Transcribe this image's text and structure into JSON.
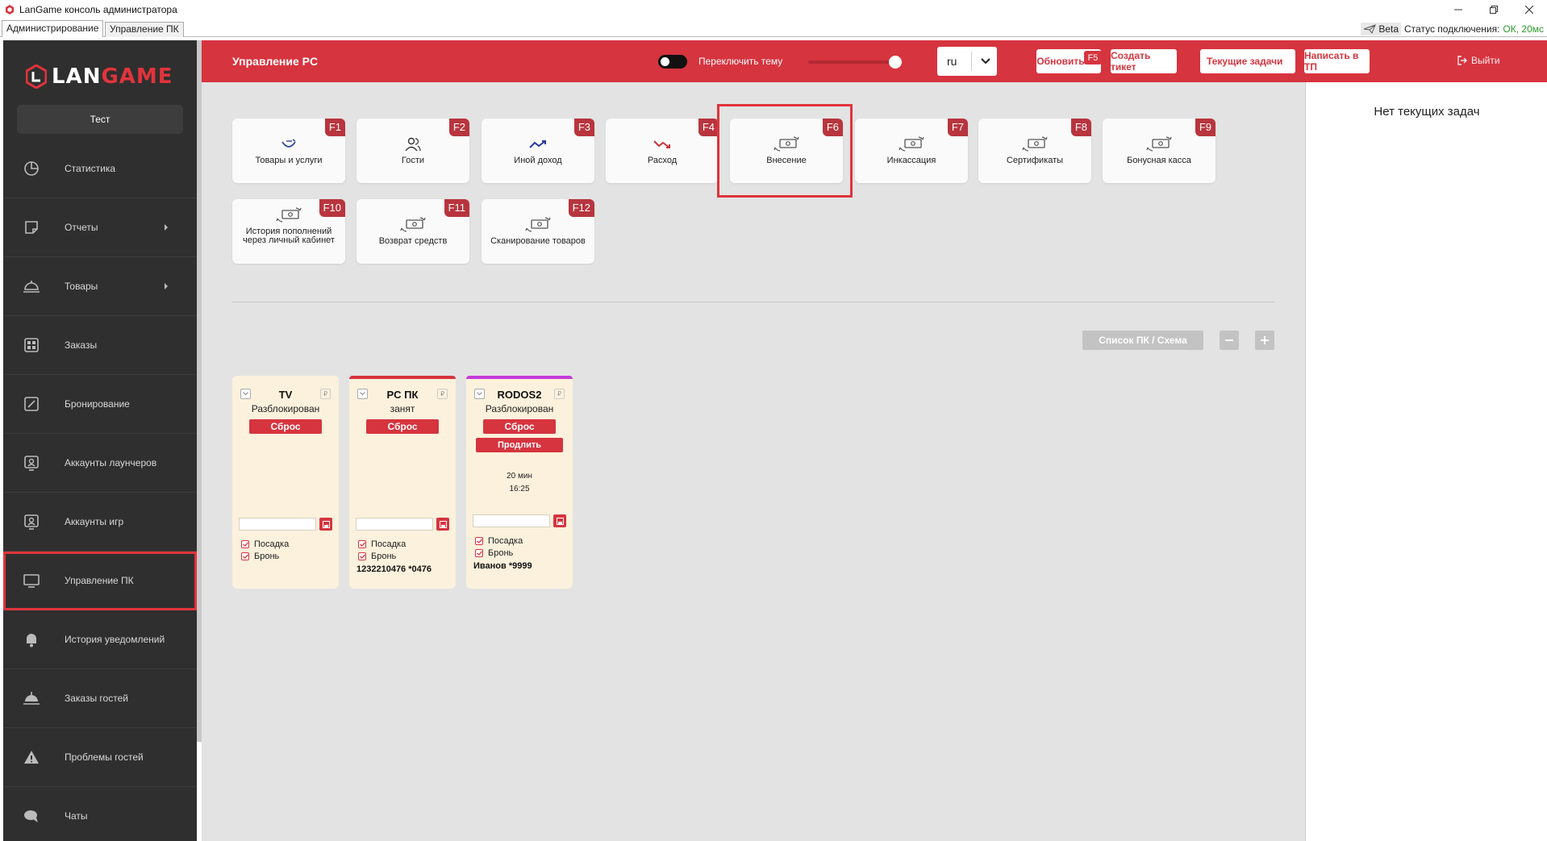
{
  "window": {
    "title": "LanGame консоль администратора",
    "tabs": [
      "Администрирование",
      "Управление ПК"
    ],
    "beta": "Beta",
    "connection_label": "Статус подключения:",
    "connection_value": "ОК, 20мс"
  },
  "sidebar": {
    "logo_prefix": "LAN",
    "logo_suffix": "GAME",
    "profile": "Тест",
    "items": [
      {
        "label": "Статистика",
        "icon": "pie-chart-icon"
      },
      {
        "label": "Отчеты",
        "icon": "note-icon"
      },
      {
        "label": "Товары",
        "icon": "cloche-icon"
      },
      {
        "label": "Заказы",
        "icon": "grid-icon"
      },
      {
        "label": "Бронирование",
        "icon": "edit-icon"
      },
      {
        "label": "Аккаунты лаунчеров",
        "icon": "account-icon"
      },
      {
        "label": "Аккаунты игр",
        "icon": "account-icon"
      },
      {
        "label": "Управление ПК",
        "icon": "monitor-icon"
      },
      {
        "label": "История уведомлений",
        "icon": "bell-icon"
      },
      {
        "label": "Заказы гостей",
        "icon": "cloche-icon"
      },
      {
        "label": "Проблемы гостей",
        "icon": "warning-icon"
      },
      {
        "label": "Чаты",
        "icon": "chat-icon"
      }
    ]
  },
  "header": {
    "title": "Управление PC",
    "theme_toggle": "Переключить тему",
    "language": "ru",
    "refresh": "Обновить",
    "refresh_key": "F5",
    "create_ticket": "Создать тикет",
    "current_tasks": "Текущие задачи",
    "write_support": "Написать в ТП",
    "logout": "Выйти"
  },
  "right_panel": {
    "no_tasks": "Нет текущих задач"
  },
  "actions": [
    {
      "label": "Товары и услуги",
      "key": "F1",
      "icon": "bowl-icon"
    },
    {
      "label": "Гости",
      "key": "F2",
      "icon": "users-icon"
    },
    {
      "label": "Иной доход",
      "key": "F3",
      "icon": "trend-up-icon"
    },
    {
      "label": "Расход",
      "key": "F4",
      "icon": "trend-down-icon"
    },
    {
      "label": "Внесение",
      "key": "F6",
      "icon": "cash-exchange-icon"
    },
    {
      "label": "Инкассация",
      "key": "F7",
      "icon": "cash-exchange-icon"
    },
    {
      "label": "Сертификаты",
      "key": "F8",
      "icon": "cash-exchange-icon"
    },
    {
      "label": "Бонусная касса",
      "key": "F9",
      "icon": "cash-exchange-icon"
    },
    {
      "label": "История пополнений через личный кабинет",
      "key": "F10",
      "icon": "cash-exchange-icon"
    },
    {
      "label": "Возврат средств",
      "key": "F11",
      "icon": "cash-exchange-icon"
    },
    {
      "label": "Сканирование товаров",
      "key": "F12",
      "icon": "cash-exchange-icon"
    }
  ],
  "pc_controls": {
    "view_toggle": "Список ПК / Схема"
  },
  "pcs": [
    {
      "name": "TV",
      "status": "Разблокирован",
      "reset": "Сброс",
      "seat": "Посадка",
      "booking": "Бронь",
      "accent": "#fbf1dc"
    },
    {
      "name": "PC ПК",
      "status": "занят",
      "reset": "Сброс",
      "seat": "Посадка",
      "booking": "Бронь",
      "footer": "1232210476 *0476",
      "accent": "#d6343f"
    },
    {
      "name": "RODOS2",
      "status": "Разблокирован",
      "reset": "Сброс",
      "extend": "Продлить",
      "time_left": "20 мин",
      "until": "16:25",
      "seat": "Посадка",
      "booking": "Бронь",
      "footer": "Иванов *9999",
      "accent": "#c33bd8"
    }
  ],
  "colors": {
    "brand_red": "#d6343f",
    "sidebar_bg": "#2f2f2f",
    "card_bg": "#fbf1dc"
  }
}
